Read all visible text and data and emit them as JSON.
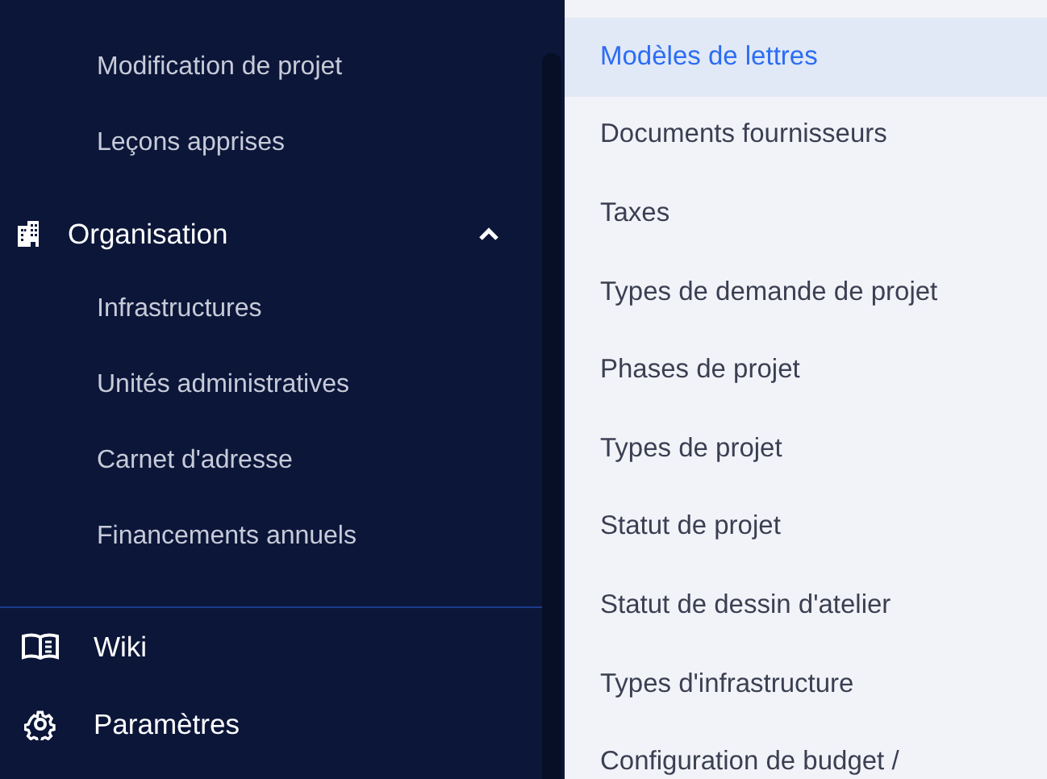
{
  "sidebar": {
    "previous_items": [
      {
        "label": "Modification de projet"
      },
      {
        "label": "Leçons apprises"
      }
    ],
    "group": {
      "label": "Organisation",
      "expanded": true,
      "children": [
        {
          "label": "Infrastructures"
        },
        {
          "label": "Unités administratives"
        },
        {
          "label": "Carnet d'adresse"
        },
        {
          "label": "Financements annuels"
        }
      ]
    },
    "footer_items": [
      {
        "label": "Wiki"
      },
      {
        "label": "Paramètres"
      }
    ]
  },
  "menu": {
    "items": [
      {
        "label": "Modèles de lettres",
        "selected": true
      },
      {
        "label": "Documents fournisseurs",
        "selected": false
      },
      {
        "label": "Taxes",
        "selected": false
      },
      {
        "label": "Types de demande de projet",
        "selected": false
      },
      {
        "label": "Phases de projet",
        "selected": false
      },
      {
        "label": "Types de projet",
        "selected": false
      },
      {
        "label": "Statut de projet",
        "selected": false
      },
      {
        "label": "Statut de dessin d'atelier",
        "selected": false
      },
      {
        "label": "Types d'infrastructure",
        "selected": false
      },
      {
        "label": "Configuration de budget /",
        "selected": false
      }
    ]
  }
}
